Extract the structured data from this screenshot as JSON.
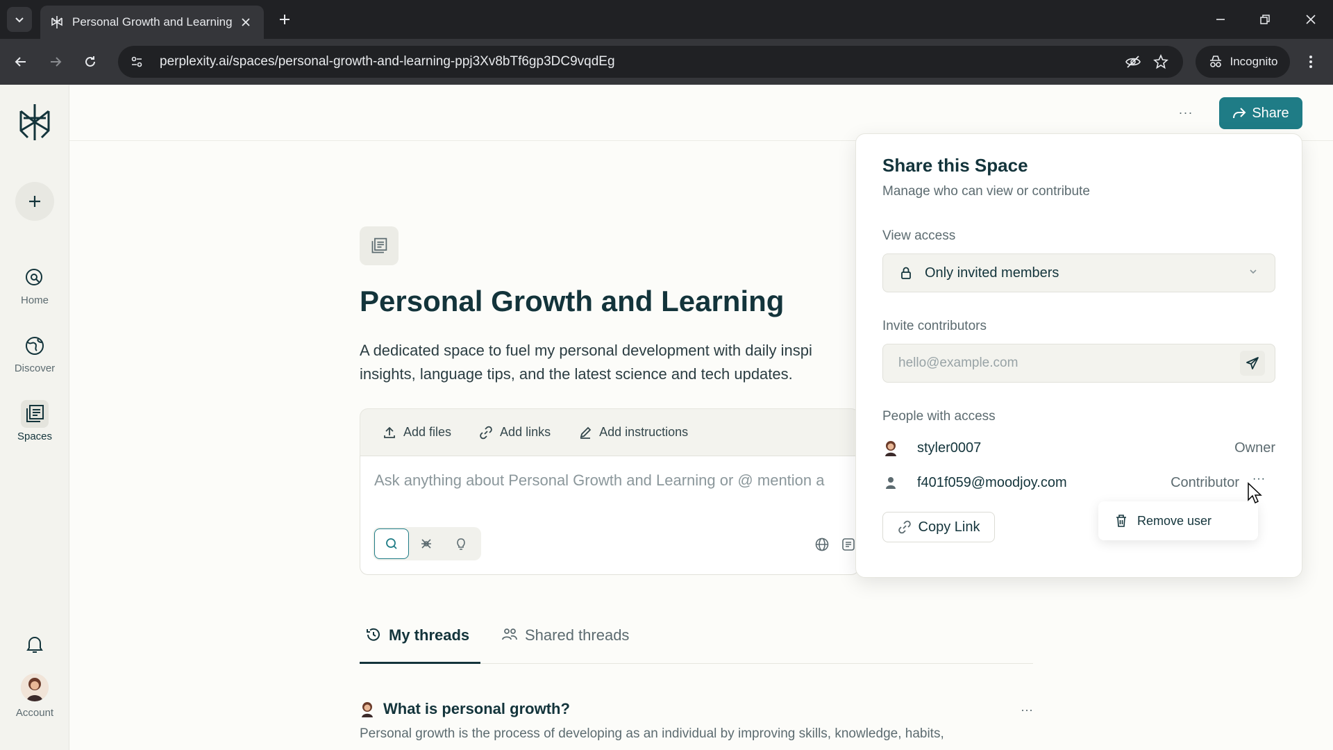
{
  "browser": {
    "tab_title": "Personal Growth and Learning",
    "url": "perplexity.ai/spaces/personal-growth-and-learning-ppj3Xv8bTf6gp3DC9vqdEg",
    "incognito_label": "Incognito"
  },
  "sidebar": {
    "items": [
      {
        "label": "Home",
        "icon": "home-search-icon"
      },
      {
        "label": "Discover",
        "icon": "globe-icon"
      },
      {
        "label": "Spaces",
        "icon": "spaces-icon"
      }
    ],
    "account_label": "Account"
  },
  "header": {
    "more_label": "···",
    "share_label": "Share"
  },
  "space": {
    "title": "Personal Growth and Learning",
    "description": "A dedicated space to fuel my personal development with daily inspi insights, language tips, and the latest science and tech updates.",
    "tools": {
      "add_files": "Add files",
      "add_links": "Add links",
      "add_instructions": "Add instructions"
    },
    "composer_placeholder": "Ask anything about Personal Growth and Learning or @ mention a"
  },
  "threads": {
    "tabs": [
      "My threads",
      "Shared threads"
    ],
    "active_tab": "My threads",
    "items": [
      {
        "title": "What is personal growth?",
        "snippet": "Personal growth is the process of developing as an individual by improving skills, knowledge, habits,"
      }
    ],
    "more_label": "···"
  },
  "share_panel": {
    "title": "Share this Space",
    "subtitle": "Manage who can view or contribute",
    "view_access_label": "View access",
    "view_access_value": "Only invited members",
    "invite_label": "Invite contributors",
    "invite_placeholder": "hello@example.com",
    "people_label": "People with access",
    "people": [
      {
        "name": "styler0007",
        "role": "Owner"
      },
      {
        "name": "f401f059@moodjoy.com",
        "role": "Contributor"
      }
    ],
    "copy_link_label": "Copy Link",
    "row_menu": {
      "remove_label": "Remove user"
    }
  },
  "colors": {
    "accent": "#1f7c86",
    "background": "#fcfcf9",
    "sidebar": "#f3f3ee",
    "text": "#13343b"
  }
}
